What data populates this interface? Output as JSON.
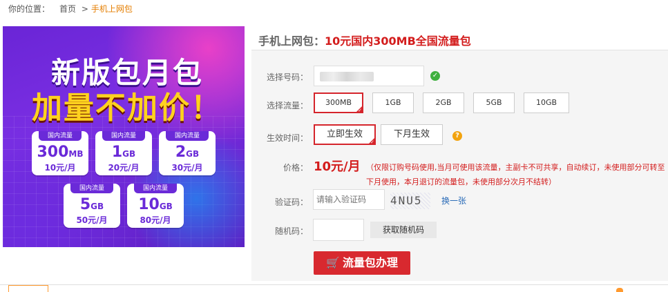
{
  "breadcrumb": {
    "prefix": "你的位置：",
    "home": "首页",
    "sep": ">",
    "current": "手机上网包"
  },
  "banner": {
    "headline1": "新版包月包",
    "headline2": "加量不加价！",
    "cards": [
      {
        "tag": "国内流量",
        "amount": "300",
        "unit": "MB",
        "price": "10元/月"
      },
      {
        "tag": "国内流量",
        "amount": "1",
        "unit": "GB",
        "price": "20元/月"
      },
      {
        "tag": "国内流量",
        "amount": "2",
        "unit": "GB",
        "price": "30元/月"
      },
      {
        "tag": "国内流量",
        "amount": "5",
        "unit": "GB",
        "price": "50元/月"
      },
      {
        "tag": "国内流量",
        "amount": "10",
        "unit": "GB",
        "price": "80元/月"
      }
    ]
  },
  "product": {
    "category": "手机上网包：",
    "name": "10元国内300MB全国流量包"
  },
  "form": {
    "phone_label": "选择号码：",
    "flow_label": "选择流量：",
    "flow_options": [
      "300MB",
      "1GB",
      "2GB",
      "5GB",
      "10GB"
    ],
    "flow_selected": "300MB",
    "effect_label": "生效时间：",
    "effect_options": [
      "立即生效",
      "下月生效"
    ],
    "effect_selected": "立即生效",
    "price_label": "价格：",
    "price_value": "10元/月",
    "price_note": "（仅限订购号码使用,当月可使用该流量，主副卡不可共享，自动续订，未使用部分可转至下月使用，本月退订的流量包，未使用部分次月不结转）",
    "captcha_label": "验证码：",
    "captcha_placeholder": "请输入验证码",
    "captcha_image_text": "4NU5",
    "captcha_refresh": "换一张",
    "random_label": "随机码：",
    "random_value": "",
    "get_code_button": "获取随机码",
    "submit_button": "流量包办理"
  },
  "colors": {
    "accent_red": "#d8292f",
    "crumb_orange": "#e57e00",
    "banner_purple": "#6a2ad8",
    "banner_yellow": "#ffd21f"
  },
  "icons": {
    "ok": "check-circle-icon",
    "help": "question-circle-icon",
    "cart": "cart-icon"
  }
}
